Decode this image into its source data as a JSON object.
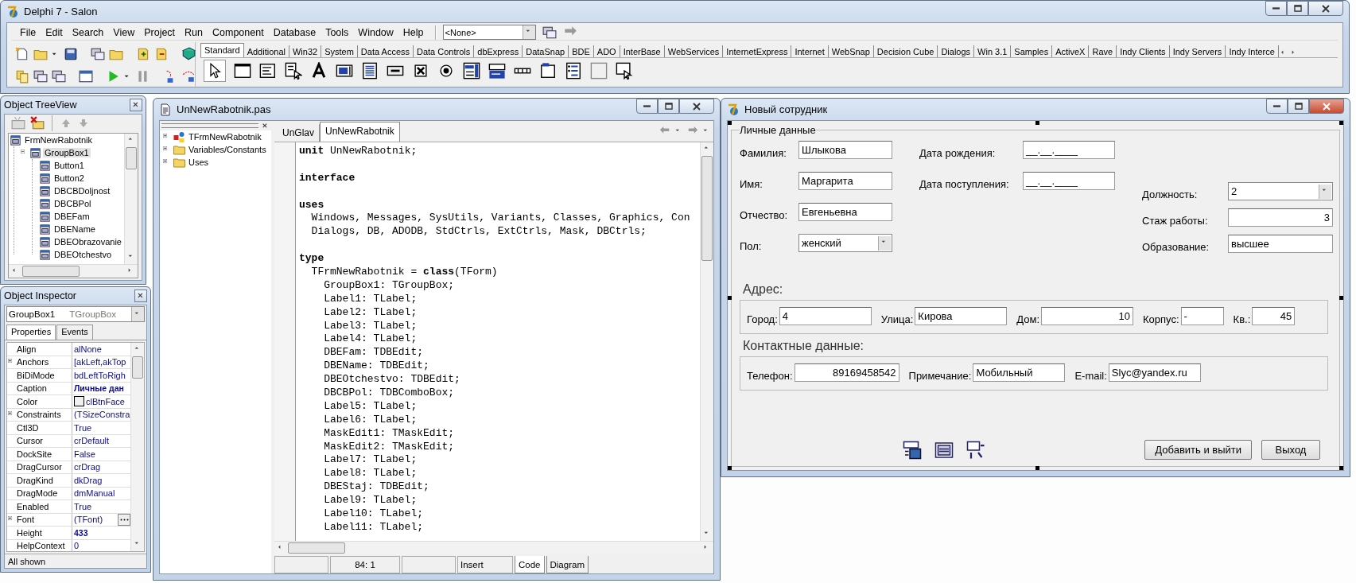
{
  "main_window": {
    "title": "Delphi 7 - Salon",
    "menu": [
      "File",
      "Edit",
      "Search",
      "View",
      "Project",
      "Run",
      "Component",
      "Database",
      "Tools",
      "Window",
      "Help"
    ],
    "component_combo": {
      "value": "<None>"
    },
    "palette_tabs": [
      {
        "label": "Standard",
        "selected": true
      },
      {
        "label": "Additional",
        "selected": false
      },
      {
        "label": "Win32",
        "selected": false
      },
      {
        "label": "System",
        "selected": false
      },
      {
        "label": "Data Access",
        "selected": false
      },
      {
        "label": "Data Controls",
        "selected": false
      },
      {
        "label": "dbExpress",
        "selected": false
      },
      {
        "label": "DataSnap",
        "selected": false
      },
      {
        "label": "BDE",
        "selected": false
      },
      {
        "label": "ADO",
        "selected": false
      },
      {
        "label": "InterBase",
        "selected": false
      },
      {
        "label": "WebServices",
        "selected": false
      },
      {
        "label": "InternetExpress",
        "selected": false
      },
      {
        "label": "Internet",
        "selected": false
      },
      {
        "label": "WebSnap",
        "selected": false
      },
      {
        "label": "Decision Cube",
        "selected": false
      },
      {
        "label": "Dialogs",
        "selected": false
      },
      {
        "label": "Win 3.1",
        "selected": false
      },
      {
        "label": "Samples",
        "selected": false
      },
      {
        "label": "ActiveX",
        "selected": false
      },
      {
        "label": "Rave",
        "selected": false
      },
      {
        "label": "Indy Clients",
        "selected": false
      },
      {
        "label": "Indy Servers",
        "selected": false
      },
      {
        "label": "Indy Interce",
        "selected": false
      }
    ]
  },
  "tree_view": {
    "title": "Object TreeView",
    "items": [
      {
        "label": "FrmNewRabotnik",
        "selected": false,
        "children": [
          {
            "label": "GroupBox1",
            "selected": true,
            "expanded": true,
            "children": [
              {
                "label": "Button1",
                "selected": false
              },
              {
                "label": "Button2",
                "selected": false
              },
              {
                "label": "DBCBDoljnost",
                "selected": false
              },
              {
                "label": "DBCBPol",
                "selected": false
              },
              {
                "label": "DBEFam",
                "selected": false
              },
              {
                "label": "DBEName",
                "selected": false
              },
              {
                "label": "DBEObrazovanie",
                "selected": false
              },
              {
                "label": "DBEOtchestvo",
                "selected": false
              }
            ]
          }
        ]
      }
    ]
  },
  "object_inspector": {
    "title": "Object Inspector",
    "object": "GroupBox1",
    "object_type": "TGroupBox",
    "tabs": [
      {
        "label": "Properties",
        "selected": true
      },
      {
        "label": "Events",
        "selected": false
      }
    ],
    "properties": [
      {
        "name": "Align",
        "value": "alNone",
        "kind": "text",
        "expandable": false,
        "bold": false
      },
      {
        "name": "Anchors",
        "value": "[akLeft,akTop",
        "kind": "text",
        "expandable": true,
        "bold": false
      },
      {
        "name": "BiDiMode",
        "value": "bdLeftToRigh",
        "kind": "text",
        "expandable": false,
        "bold": false
      },
      {
        "name": "Caption",
        "value": "Личные дан",
        "kind": "text",
        "expandable": false,
        "bold": true
      },
      {
        "name": "Color",
        "value": "clBtnFace",
        "kind": "color",
        "expandable": false,
        "bold": false
      },
      {
        "name": "Constraints",
        "value": "(TSizeConstra",
        "kind": "text",
        "expandable": true,
        "bold": false
      },
      {
        "name": "Ctl3D",
        "value": "True",
        "kind": "text",
        "expandable": false,
        "bold": false
      },
      {
        "name": "Cursor",
        "value": "crDefault",
        "kind": "text",
        "expandable": false,
        "bold": false
      },
      {
        "name": "DockSite",
        "value": "False",
        "kind": "text",
        "expandable": false,
        "bold": false
      },
      {
        "name": "DragCursor",
        "value": "crDrag",
        "kind": "text",
        "expandable": false,
        "bold": false
      },
      {
        "name": "DragKind",
        "value": "dkDrag",
        "kind": "text",
        "expandable": false,
        "bold": false
      },
      {
        "name": "DragMode",
        "value": "dmManual",
        "kind": "text",
        "expandable": false,
        "bold": false
      },
      {
        "name": "Enabled",
        "value": "True",
        "kind": "text",
        "expandable": false,
        "bold": false
      },
      {
        "name": "Font",
        "value": "(TFont)",
        "kind": "ellipsis",
        "expandable": true,
        "bold": false
      },
      {
        "name": "Height",
        "value": "433",
        "kind": "text",
        "expandable": false,
        "bold": true
      },
      {
        "name": "HelpContext",
        "value": "0",
        "kind": "text",
        "expandable": false,
        "bold": false
      }
    ],
    "status": "All shown"
  },
  "code_editor": {
    "title": "UnNewRabotnik.pas",
    "explorer": [
      {
        "label": "TFrmNewRabotnik",
        "kind": "class"
      },
      {
        "label": "Variables/Constants",
        "kind": "folder"
      },
      {
        "label": "Uses",
        "kind": "folder"
      }
    ],
    "tabs": [
      {
        "label": "UnGlav",
        "selected": false
      },
      {
        "label": "UnNewRabotnik",
        "selected": true
      }
    ],
    "code_blocks": [
      [
        "**unit** UnNewRabotnik;"
      ],
      [
        "**interface**"
      ],
      [
        "**uses**",
        "  Windows, Messages, SysUtils, Variants, Classes, Graphics, Con",
        "  Dialogs, DB, ADODB, StdCtrls, ExtCtrls, Mask, DBCtrls;"
      ],
      [
        "**type**",
        "  TFrmNewRabotnik = **class**(TForm)",
        "    GroupBox1: TGroupBox;",
        "    Label1: TLabel;",
        "    Label2: TLabel;",
        "    Label3: TLabel;",
        "    Label4: TLabel;",
        "    DBEFam: TDBEdit;",
        "    DBEName: TDBEdit;",
        "    DBEOtchestvo: TDBEdit;",
        "    DBCBPol: TDBComboBox;",
        "    Label5: TLabel;",
        "    Label6: TLabel;",
        "    MaskEdit1: TMaskEdit;",
        "    MaskEdit2: TMaskEdit;",
        "    Label7: TLabel;",
        "    Label8: TLabel;",
        "    DBEStaj: TDBEdit;",
        "    Label9: TLabel;",
        "    Label10: TLabel;",
        "    Label11: TLabel;"
      ]
    ],
    "cursor_position": "84:  1",
    "mode": "Insert",
    "view_tabs": [
      {
        "label": "Code",
        "selected": true
      },
      {
        "label": "Diagram",
        "selected": false
      }
    ]
  },
  "employee_form": {
    "title": "Новый сотрудник",
    "group_caption": "Личные данные",
    "personal_columns": [
      [
        {
          "label": "Фамилия:",
          "value": "Шлыкова",
          "kind": "text"
        },
        {
          "label": "Имя:",
          "value": "Маргарита",
          "kind": "text"
        },
        {
          "label": "Отчество:",
          "value": "Евгеньевна",
          "kind": "text"
        },
        {
          "label": "Пол:",
          "value": "женский",
          "kind": "combo"
        }
      ],
      [
        {
          "label": "Дата рождения:",
          "value": "__.__.____",
          "kind": "text"
        },
        {
          "label": "Дата поступления:",
          "value": "__.__.____",
          "kind": "text"
        }
      ],
      [
        {
          "label": "Должность:",
          "value": "2",
          "kind": "combo"
        },
        {
          "label": "Стаж работы:",
          "value": "3",
          "kind": "number"
        },
        {
          "label": "Образование:",
          "value": "высшее",
          "kind": "text"
        }
      ]
    ],
    "address_heading": "Адрес:",
    "address_fields": [
      {
        "label": "Город:",
        "value": "4",
        "kind": "text"
      },
      {
        "label": "Улица:",
        "value": "Кирова",
        "kind": "text"
      },
      {
        "label": "Дом:",
        "value": "10",
        "kind": "number"
      },
      {
        "label": "Корпус:",
        "value": "-",
        "kind": "text"
      },
      {
        "label": "Кв.:",
        "value": "45",
        "kind": "number"
      }
    ],
    "contacts_heading": "Контактные данные:",
    "contact_fields": [
      {
        "label": "Телефон:",
        "value": "89169458542",
        "kind": "number"
      },
      {
        "label": "Примечание:",
        "value": "Мобильный",
        "kind": "text"
      },
      {
        "label": "E-mail:",
        "value": "Slyc@yandex.ru",
        "kind": "text"
      }
    ],
    "buttons": [
      "Добавить и выйти",
      "Выход"
    ]
  }
}
